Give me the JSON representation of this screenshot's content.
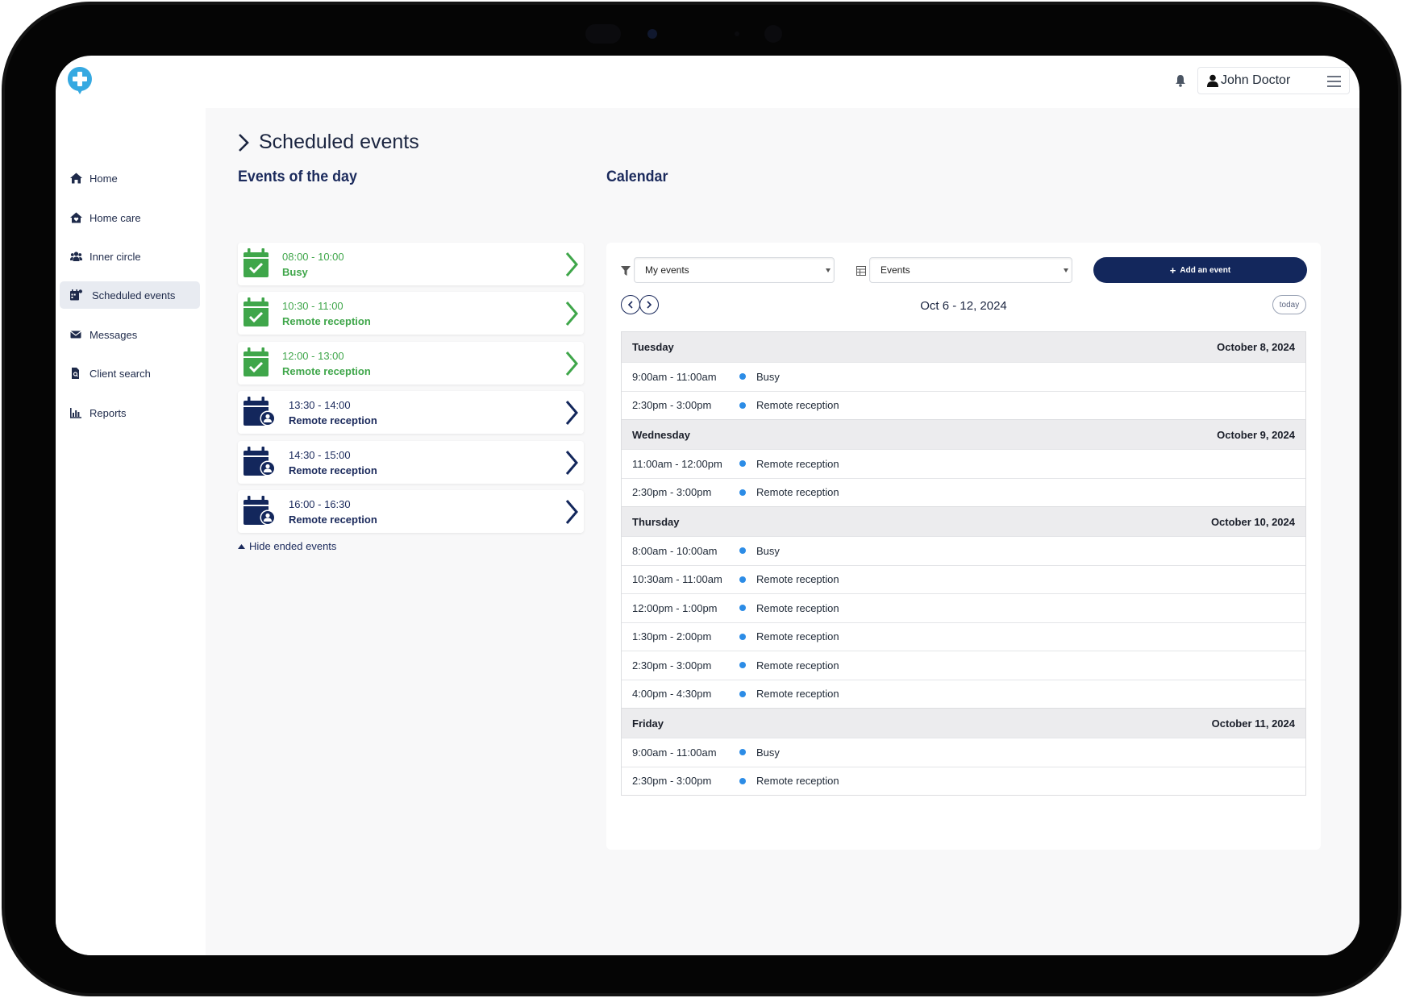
{
  "header": {
    "user_name": "John Doctor"
  },
  "sidebar": {
    "items": [
      {
        "label": "Home",
        "icon": "home-icon"
      },
      {
        "label": "Home care",
        "icon": "home-care-icon"
      },
      {
        "label": "Inner circle",
        "icon": "users-icon"
      },
      {
        "label": "Scheduled events",
        "icon": "calendar-user-icon",
        "active": true
      },
      {
        "label": "Messages",
        "icon": "envelope-icon"
      },
      {
        "label": "Client search",
        "icon": "file-search-icon"
      },
      {
        "label": "Reports",
        "icon": "chart-icon"
      }
    ]
  },
  "page": {
    "title": "Scheduled events",
    "events_title": "Events of the day",
    "calendar_title": "Calendar"
  },
  "events": [
    {
      "time": "08:00 - 10:00",
      "title": "Busy",
      "status": "done"
    },
    {
      "time": "10:30 - 11:00",
      "title": "Remote reception",
      "status": "done"
    },
    {
      "time": "12:00 - 13:00",
      "title": "Remote reception",
      "status": "done"
    },
    {
      "time": "13:30 - 14:00",
      "title": "Remote reception",
      "status": "upcoming"
    },
    {
      "time": "14:30 - 15:00",
      "title": "Remote reception",
      "status": "upcoming"
    },
    {
      "time": "16:00 - 16:30",
      "title": "Remote reception",
      "status": "upcoming"
    }
  ],
  "hide_ended_label": "Hide ended events",
  "calendar": {
    "filter_value": "My events",
    "view_value": "Events",
    "add_label": "Add an event",
    "range": "Oct 6 - 12, 2024",
    "today_label": "today",
    "days": [
      {
        "name": "Tuesday",
        "date": "October 8, 2024",
        "items": [
          {
            "time": "9:00am - 11:00am",
            "title": "Busy"
          },
          {
            "time": "2:30pm - 3:00pm",
            "title": "Remote reception"
          }
        ]
      },
      {
        "name": "Wednesday",
        "date": "October 9, 2024",
        "items": [
          {
            "time": "11:00am - 12:00pm",
            "title": "Remote reception"
          },
          {
            "time": "2:30pm - 3:00pm",
            "title": "Remote reception"
          }
        ]
      },
      {
        "name": "Thursday",
        "date": "October 10, 2024",
        "items": [
          {
            "time": "8:00am - 10:00am",
            "title": "Busy"
          },
          {
            "time": "10:30am - 11:00am",
            "title": "Remote reception"
          },
          {
            "time": "12:00pm - 1:00pm",
            "title": "Remote reception"
          },
          {
            "time": "1:30pm - 2:00pm",
            "title": "Remote reception"
          },
          {
            "time": "2:30pm - 3:00pm",
            "title": "Remote reception"
          },
          {
            "time": "4:00pm - 4:30pm",
            "title": "Remote reception"
          }
        ]
      },
      {
        "name": "Friday",
        "date": "October 11, 2024",
        "items": [
          {
            "time": "9:00am - 11:00am",
            "title": "Busy"
          },
          {
            "time": "2:30pm - 3:00pm",
            "title": "Remote reception"
          }
        ]
      }
    ]
  },
  "colors": {
    "navy": "#13275c",
    "done_green": "#3fa64a",
    "dot_blue": "#2c8ce6",
    "logo_blue": "#36a9e1"
  }
}
